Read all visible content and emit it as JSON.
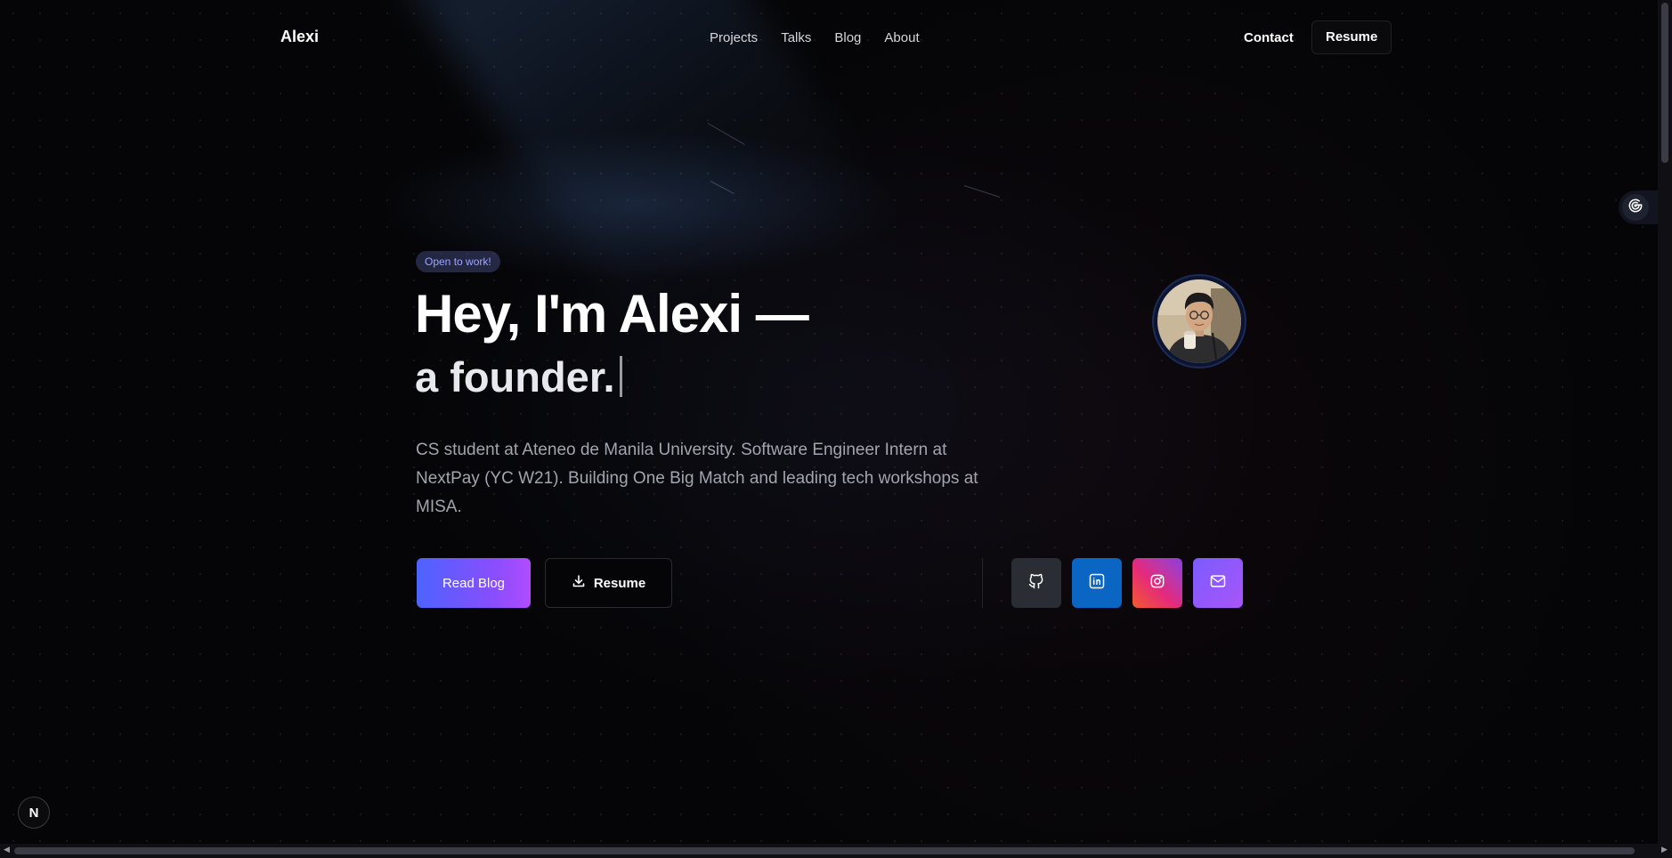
{
  "nav": {
    "brand": "Alexi",
    "links": [
      "Projects",
      "Talks",
      "Blog",
      "About"
    ],
    "contact": "Contact",
    "resume": "Resume"
  },
  "hero": {
    "badge": "Open to work!",
    "headline": "Hey, I'm Alexi —",
    "subline": "a founder.",
    "description": "CS student at Ateneo de Manila University. Software Engineer Intern at NextPay (YC W21). Building One Big Match and leading tech workshops at MISA.",
    "read_blog": "Read Blog",
    "resume": "Resume"
  },
  "social": [
    {
      "name": "github-icon",
      "color": "#2a2d33"
    },
    {
      "name": "linkedin-icon",
      "color": "#0a66c2"
    },
    {
      "name": "instagram-icon",
      "color": "#e52a7c"
    },
    {
      "name": "mail-icon",
      "color": "#8b5cf6"
    }
  ],
  "next_badge": "N",
  "colors": {
    "background": "#050507",
    "accent_start": "#4d63ff",
    "accent_end": "#b24cff",
    "badge_text": "#9aa6ff"
  }
}
